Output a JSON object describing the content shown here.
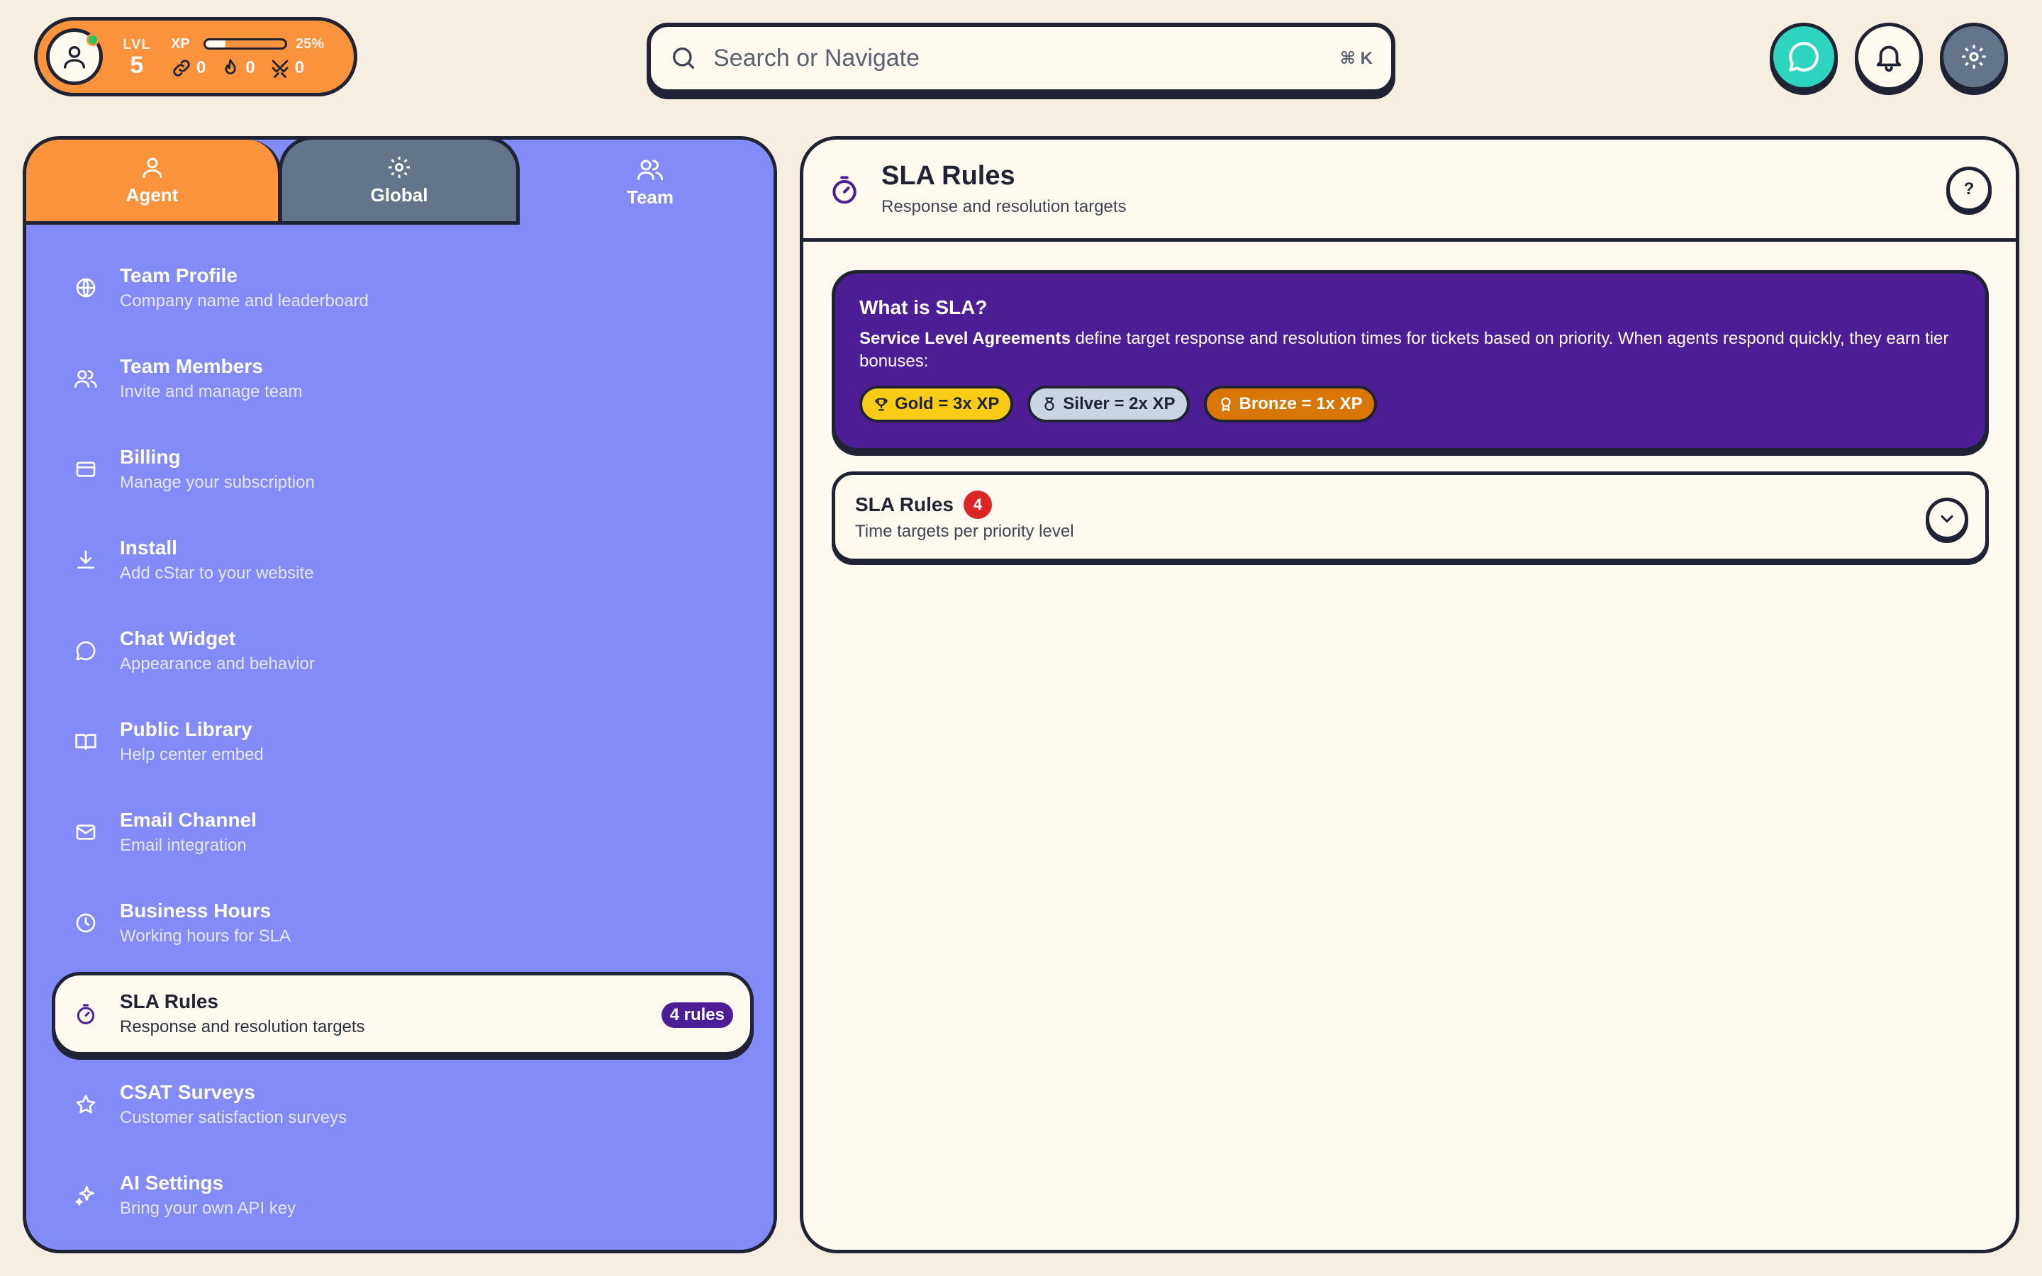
{
  "player": {
    "level_label": "LVL",
    "level": "5",
    "xp_label": "XP",
    "xp_percent": "25%",
    "xp_fraction": 0.25,
    "stat_links": "0",
    "stat_streak": "0",
    "stat_battles": "0"
  },
  "search": {
    "placeholder": "Search or Navigate",
    "shortcut": "⌘ K"
  },
  "tabs": [
    {
      "label": "Agent",
      "icon": "user-icon"
    },
    {
      "label": "Global",
      "icon": "gear-icon"
    },
    {
      "label": "Team",
      "icon": "users-icon"
    }
  ],
  "nav": [
    {
      "title": "Team Profile",
      "subtitle": "Company name and leaderboard",
      "icon": "globe-icon"
    },
    {
      "title": "Team Members",
      "subtitle": "Invite and manage team",
      "icon": "users-icon"
    },
    {
      "title": "Billing",
      "subtitle": "Manage your subscription",
      "icon": "credit-card-icon"
    },
    {
      "title": "Install",
      "subtitle": "Add cStar to your website",
      "icon": "download-icon"
    },
    {
      "title": "Chat Widget",
      "subtitle": "Appearance and behavior",
      "icon": "chat-bubble-icon"
    },
    {
      "title": "Public Library",
      "subtitle": "Help center embed",
      "icon": "book-icon"
    },
    {
      "title": "Email Channel",
      "subtitle": "Email integration",
      "icon": "mail-icon"
    },
    {
      "title": "Business Hours",
      "subtitle": "Working hours for SLA",
      "icon": "clock-icon"
    },
    {
      "title": "SLA Rules",
      "subtitle": "Response and resolution targets",
      "icon": "timer-icon",
      "badge": "4 rules",
      "active": true
    },
    {
      "title": "CSAT Surveys",
      "subtitle": "Customer satisfaction surveys",
      "icon": "star-icon"
    },
    {
      "title": "AI Settings",
      "subtitle": "Bring your own API key",
      "icon": "sparkles-icon"
    }
  ],
  "panel": {
    "title": "SLA Rules",
    "subtitle": "Response and resolution targets",
    "help": "?"
  },
  "info": {
    "title": "What is SLA?",
    "body_bold": "Service Level Agreements",
    "body_rest": " define target response and resolution times for tickets based on priority. When agents respond quickly, they earn tier bonuses:",
    "tiers": [
      {
        "label": "Gold = 3x XP",
        "color": "#facc15"
      },
      {
        "label": "Silver = 2x XP",
        "color": "#cbd5e1"
      },
      {
        "label": "Bronze = 1x XP",
        "color": "#d97706"
      }
    ]
  },
  "rules_section": {
    "title": "SLA Rules",
    "count": "4",
    "subtitle": "Time targets per priority level"
  },
  "colors": {
    "background": "#f6efe1",
    "accent_orange": "#fb923c",
    "team_purple": "#818cf8",
    "deep_purple": "#4c1d95",
    "chat_teal": "#2dd4bf",
    "slate": "#64748b"
  }
}
